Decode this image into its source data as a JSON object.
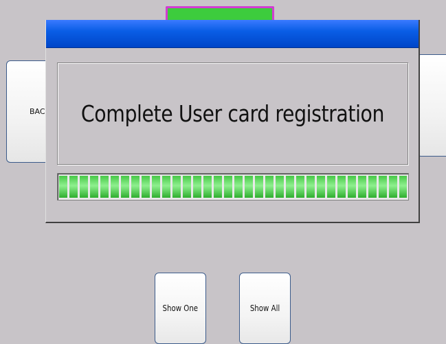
{
  "buttons": {
    "back_label": "BAC",
    "show_one_label": "Show One",
    "show_all_label": "Show All"
  },
  "dialog": {
    "message": "Complete User card registration",
    "progress_percent": 100
  },
  "colors": {
    "background": "#c8c4c8",
    "title_bar": "#0a5ee6",
    "progress_green": "#46c846",
    "tab_fill": "#3dcc3d",
    "tab_border": "#d23cd2"
  }
}
